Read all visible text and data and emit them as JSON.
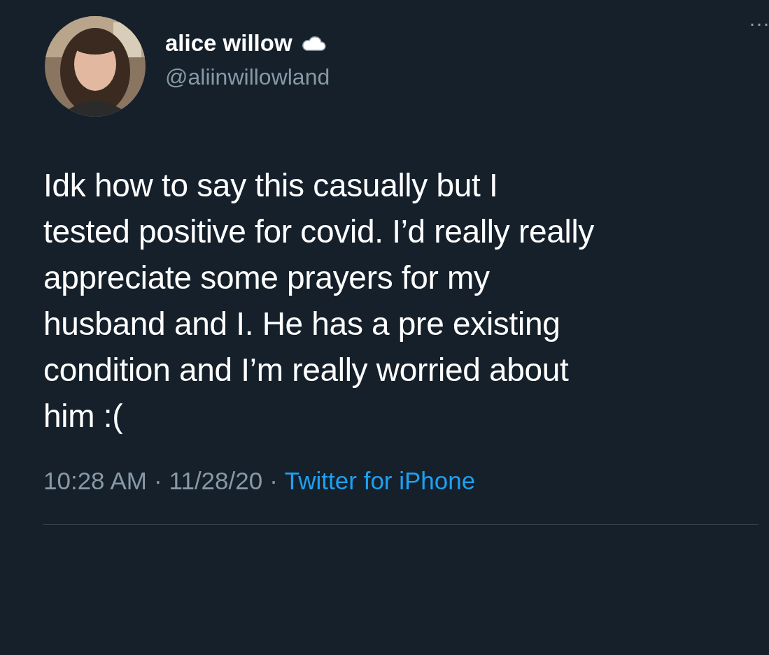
{
  "author": {
    "name": "alice willow",
    "handle": "@aliinwillowland"
  },
  "more": "···",
  "tweet": {
    "text": "Idk how to say this casually but I\ntested positive for covid. I’d really really\nappreciate some prayers for my\nhusband and I. He has a pre existing\ncondition and I’m really worried about\nhim :("
  },
  "meta": {
    "time": "10:28 AM",
    "separator_1": "·",
    "date": "11/28/20",
    "separator_2": "·",
    "source": "Twitter for iPhone"
  }
}
